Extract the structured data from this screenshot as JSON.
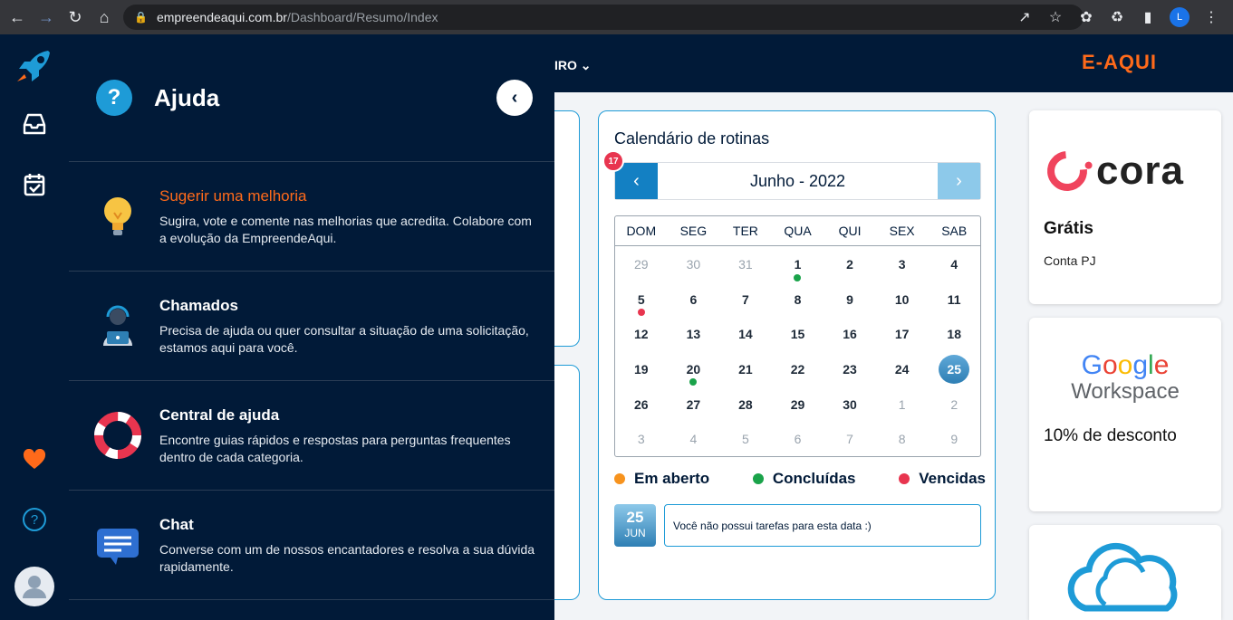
{
  "browser": {
    "url_domain": "empreendeaqui.com.br",
    "url_path": "/Dashboard/Resumo/Index",
    "profile_initial": "L"
  },
  "header": {
    "menu_fragment": "IRO",
    "brand": "E-AQUI"
  },
  "rail": {
    "icons": [
      "rocket-icon",
      "inbox-icon",
      "calendar-check-icon",
      "heart-icon",
      "help-circle-icon",
      "avatar-icon"
    ]
  },
  "help": {
    "title": "Ajuda",
    "items": [
      {
        "title": "Sugerir uma melhoria",
        "description": "Sugira, vote e comente nas melhorias que acredita. Colabore com a evolução da EmpreendeAqui.",
        "icon": "lightbulb-icon"
      },
      {
        "title": "Chamados",
        "description": "Precisa de ajuda ou quer consultar a situação de uma solicitação, estamos aqui para você.",
        "icon": "support-agent-icon"
      },
      {
        "title": "Central de ajuda",
        "description": "Encontre guias rápidos e respostas para perguntas frequentes dentro de cada categoria.",
        "icon": "lifebuoy-icon"
      },
      {
        "title": "Chat",
        "description": "Converse com um de nossos encantadores e resolva a sua dúvida rapidamente.",
        "icon": "chat-icon"
      }
    ]
  },
  "calendar": {
    "title": "Calendário de rotinas",
    "month_label": "Junho - 2022",
    "badge": "17",
    "weekdays": [
      "DOM",
      "SEG",
      "TER",
      "QUA",
      "QUI",
      "SEX",
      "SAB"
    ],
    "days": [
      {
        "n": "29",
        "muted": true
      },
      {
        "n": "30",
        "muted": true
      },
      {
        "n": "31",
        "muted": true
      },
      {
        "n": "1",
        "dot": "green"
      },
      {
        "n": "2"
      },
      {
        "n": "3"
      },
      {
        "n": "4"
      },
      {
        "n": "5",
        "dot": "red"
      },
      {
        "n": "6"
      },
      {
        "n": "7"
      },
      {
        "n": "8"
      },
      {
        "n": "9"
      },
      {
        "n": "10"
      },
      {
        "n": "11"
      },
      {
        "n": "12"
      },
      {
        "n": "13"
      },
      {
        "n": "14"
      },
      {
        "n": "15"
      },
      {
        "n": "16"
      },
      {
        "n": "17"
      },
      {
        "n": "18"
      },
      {
        "n": "19"
      },
      {
        "n": "20",
        "dot": "green"
      },
      {
        "n": "21"
      },
      {
        "n": "22"
      },
      {
        "n": "23"
      },
      {
        "n": "24"
      },
      {
        "n": "25",
        "today": true
      },
      {
        "n": "26"
      },
      {
        "n": "27"
      },
      {
        "n": "28"
      },
      {
        "n": "29"
      },
      {
        "n": "30"
      },
      {
        "n": "1",
        "muted": true
      },
      {
        "n": "2",
        "muted": true
      },
      {
        "n": "3",
        "muted": true
      },
      {
        "n": "4",
        "muted": true
      },
      {
        "n": "5",
        "muted": true
      },
      {
        "n": "6",
        "muted": true
      },
      {
        "n": "7",
        "muted": true
      },
      {
        "n": "8",
        "muted": true
      },
      {
        "n": "9",
        "muted": true
      }
    ],
    "legend": [
      {
        "label": "Em aberto",
        "color": "#f7931e"
      },
      {
        "label": "Concluídas",
        "color": "#1aa34a"
      },
      {
        "label": "Vencidas",
        "color": "#e8354f"
      }
    ],
    "selected_day": "25",
    "selected_month": "JUN",
    "empty_message": "Você não possui tarefas para esta data :)"
  },
  "colors": {
    "green_dot": "#1aa34a",
    "red_dot": "#e8354f"
  },
  "promos": {
    "cora": {
      "logo_text": "cora",
      "title": "Grátis",
      "subtitle": "Conta PJ"
    },
    "google": {
      "logo_text": "Google",
      "product": "Workspace",
      "title": "10% de desconto"
    }
  }
}
